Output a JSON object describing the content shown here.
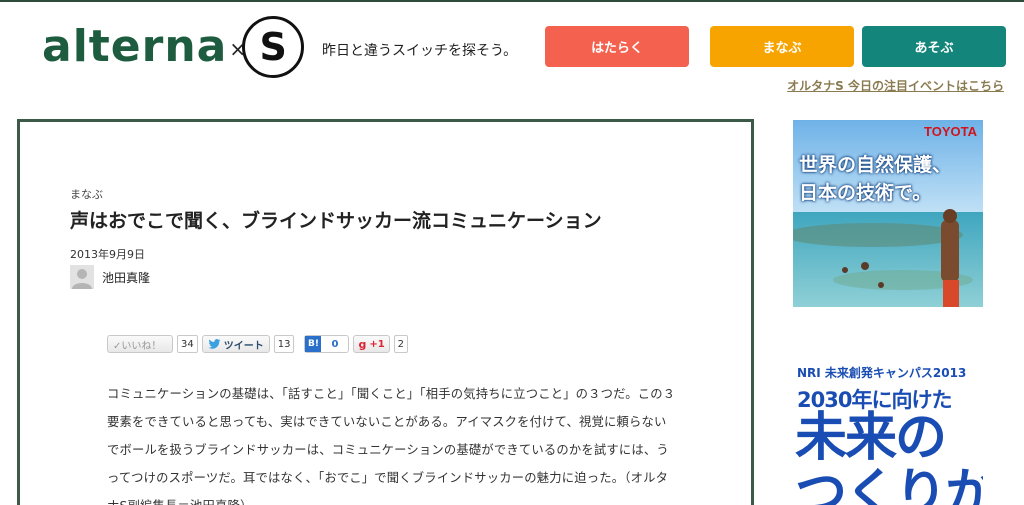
{
  "site": {
    "logo_text": "alterna",
    "logo_x": "×",
    "logo_s": "S",
    "tagline": "昨日と違うスイッチを探そう。"
  },
  "nav": {
    "items": [
      {
        "label": "はたらく",
        "color": "#f4614e"
      },
      {
        "label": "まなぶ",
        "color": "#f7a400"
      },
      {
        "label": "あそぶ",
        "color": "#14857a"
      }
    ],
    "event_link": "オルタナS 今日の注目イベントはこちら"
  },
  "article": {
    "category": "まなぶ",
    "title": "声はおでこで聞く、ブラインドサッカー流コミュニケーション",
    "date": "2013年9月9日",
    "author": "池田真隆",
    "social": {
      "like_label": "✓いいね！",
      "like_count": "34",
      "tweet_label": "ツイート",
      "tweet_count": "13",
      "hatena_label": "B!",
      "hatena_count": "0",
      "gplus_label": "g",
      "gplus_text": "+1",
      "gplus_count": "2"
    },
    "body": "コミュニケーションの基礎は、「話すこと」「聞くこと」「相手の気持ちに立つこと」の３つだ。この３要素をできていると思っても、実はできていないことがある。アイマスクを付けて、視覚に頼らないでボールを扱うブラインドサッカーは、コミュニケーションの基礎ができているのかを試すには、うってつけのスポーツだ。耳ではなく、「おでこ」で聞くブラインドサッカーの魅力に迫った。（オルタナS副編集長＝池田真隆）"
  },
  "ads": {
    "toyota": {
      "brand": "TOYOTA",
      "line1": "世界の自然保護、",
      "line2": "日本の技術で。"
    },
    "nri": {
      "line1": "NRI 未来創発キャンパス2013",
      "line2": "2030年に向けた",
      "line3": "未来の",
      "line4": "つくりかた"
    }
  },
  "colors": {
    "brand_green": "#1e5c3f",
    "frame": "#3c5a48",
    "link": "#8a7a50"
  }
}
